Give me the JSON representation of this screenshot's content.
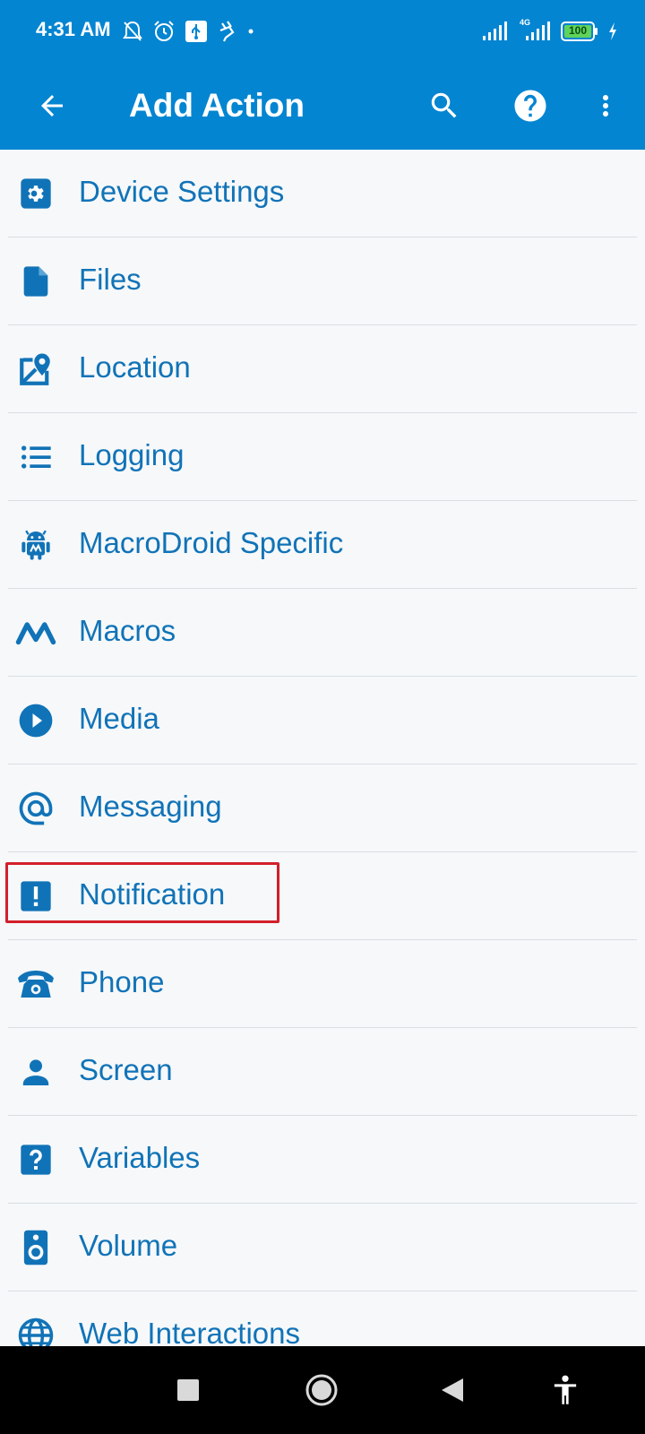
{
  "status_bar": {
    "time": "4:31 AM",
    "left_icons": [
      "muted-bell-icon",
      "alarm-icon",
      "usb-icon",
      "charging-plug-icon",
      "dot-icon"
    ],
    "network_label": "4G",
    "battery": "100",
    "battery_color": "#5fd35a"
  },
  "toolbar": {
    "back_icon": "arrow-back-icon",
    "title": "Add Action",
    "search_icon": "search-icon",
    "help_icon": "help-circle-icon",
    "more_icon": "more-vert-icon"
  },
  "colors": {
    "appbar": "#0385d1",
    "accent": "#1173b7",
    "highlight": "#d21f2a"
  },
  "categories": [
    {
      "label": "Device Settings",
      "icon": "gear-icon"
    },
    {
      "label": "Files",
      "icon": "file-icon"
    },
    {
      "label": "Location",
      "icon": "map-pin-icon"
    },
    {
      "label": "Logging",
      "icon": "list-icon"
    },
    {
      "label": "MacroDroid Specific",
      "icon": "android-icon"
    },
    {
      "label": "Macros",
      "icon": "macrodroid-logo-icon"
    },
    {
      "label": "Media",
      "icon": "play-circle-icon"
    },
    {
      "label": "Messaging",
      "icon": "at-sign-icon"
    },
    {
      "label": "Notification",
      "icon": "alert-box-icon",
      "highlighted": true
    },
    {
      "label": "Phone",
      "icon": "phone-icon"
    },
    {
      "label": "Screen",
      "icon": "person-icon"
    },
    {
      "label": "Variables",
      "icon": "question-box-icon"
    },
    {
      "label": "Volume",
      "icon": "speaker-icon"
    },
    {
      "label": "Web Interactions",
      "icon": "globe-icon"
    }
  ],
  "nav_bar": {
    "recents_icon": "square-icon",
    "home_icon": "circle-icon",
    "back_icon": "triangle-back-icon",
    "accessibility_icon": "accessibility-icon"
  }
}
